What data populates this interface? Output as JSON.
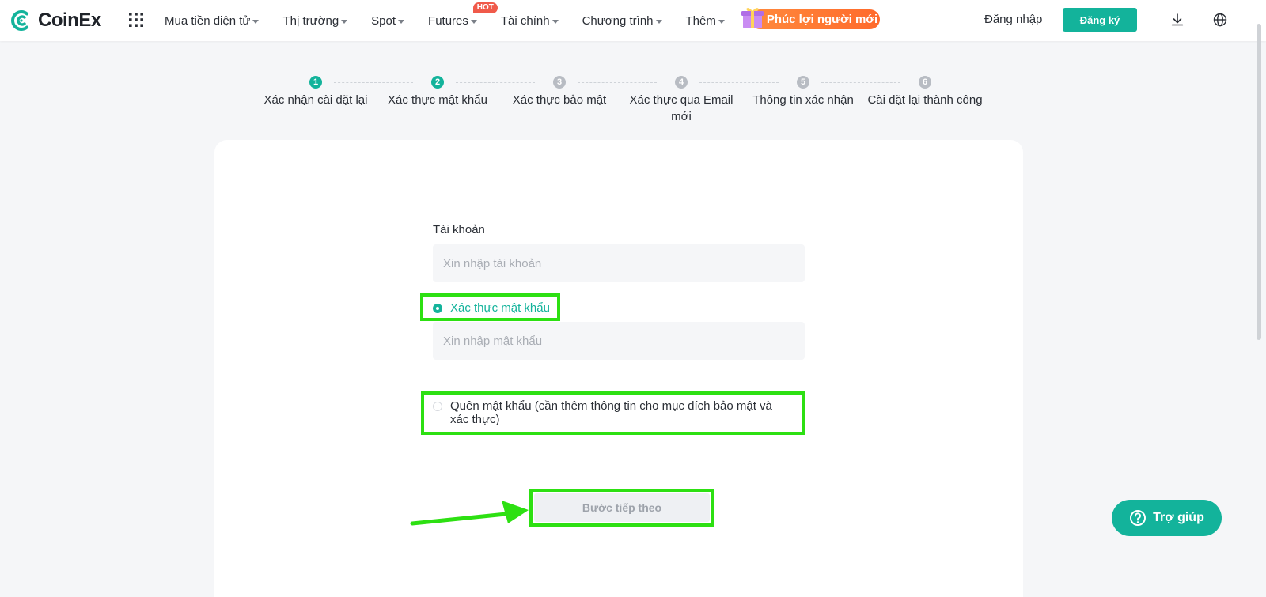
{
  "header": {
    "logo_text": "CoinEx",
    "nav": [
      {
        "label": "Mua tiền điện tử",
        "has_caret": true
      },
      {
        "label": "Thị trường",
        "has_caret": true
      },
      {
        "label": "Spot",
        "has_caret": true
      },
      {
        "label": "Futures",
        "has_caret": true,
        "badge": "HOT"
      },
      {
        "label": "Tài chính",
        "has_caret": true
      },
      {
        "label": "Chương trình",
        "has_caret": true
      },
      {
        "label": "Thêm",
        "has_caret": true
      }
    ],
    "promo_label": "Phúc lợi người mới",
    "login_label": "Đăng nhập",
    "register_label": "Đăng ký",
    "icons": [
      "apps-grid-icon",
      "download-icon",
      "globe-icon"
    ]
  },
  "steps": [
    {
      "number": "1",
      "label": "Xác nhận cài đặt lại",
      "active": true
    },
    {
      "number": "2",
      "label": "Xác thực mật khẩu",
      "active": true
    },
    {
      "number": "3",
      "label": "Xác thực bảo mật",
      "active": false
    },
    {
      "number": "4",
      "label": "Xác thực qua Email mới",
      "active": false
    },
    {
      "number": "5",
      "label": "Thông tin xác nhận",
      "active": false
    },
    {
      "number": "6",
      "label": "Cài đặt lại thành công",
      "active": false
    }
  ],
  "form": {
    "account_label": "Tài khoản",
    "account_placeholder": "Xin nhập tài khoản",
    "option_password_label": "Xác thực mật khẩu",
    "password_placeholder": "Xin nhập mật khẩu",
    "option_forgot_label": "Quên mật khẩu (cần thêm thông tin cho mục đích bảo mật và xác thực)",
    "next_label": "Bước tiếp theo"
  },
  "help_label": "Trợ giúp",
  "colors": {
    "brand": "#13b39b",
    "highlight": "#2de012",
    "promo": "#ff7a33",
    "hot": "#f05a4a"
  }
}
